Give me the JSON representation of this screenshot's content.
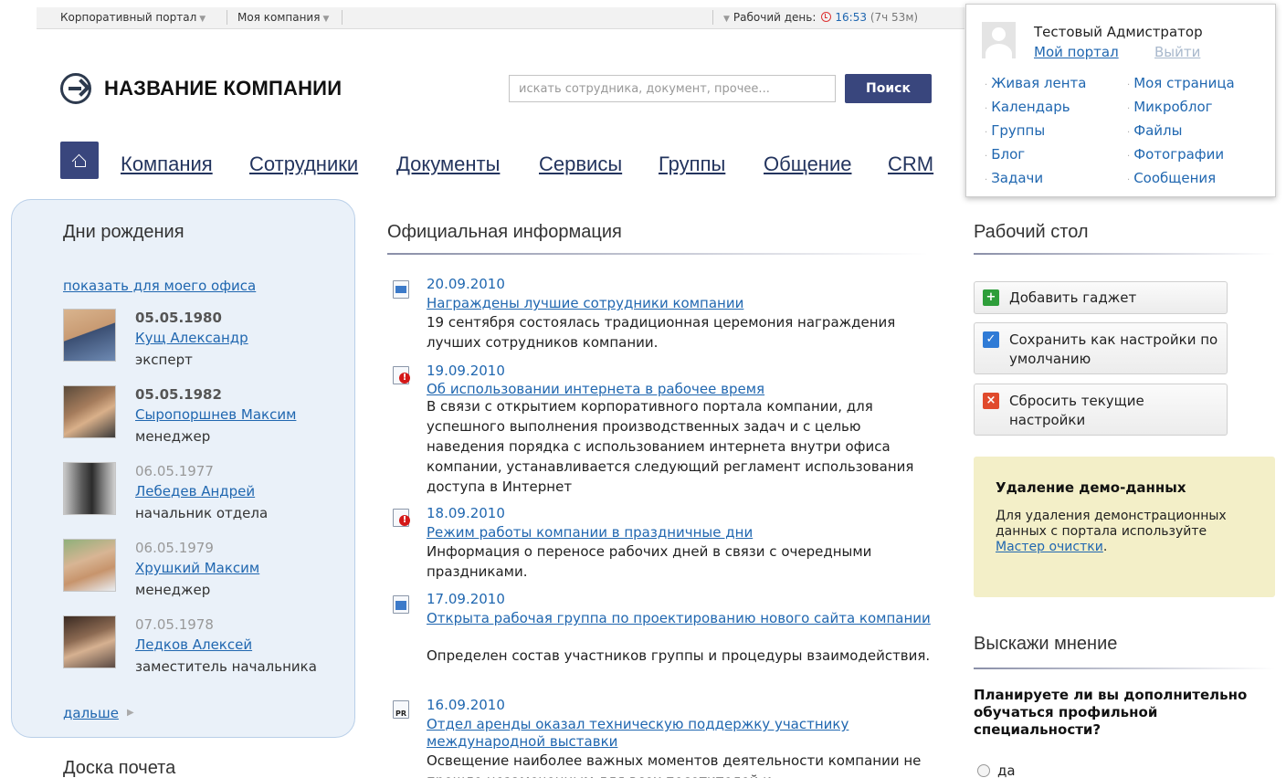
{
  "topbar": {
    "portal_menu": "Корпоративный портал",
    "company_menu": "Моя компания",
    "workday_label": "Рабочий день:",
    "time": "16:53",
    "time_extra": "(7ч 53м)"
  },
  "logo": {
    "text": "НАЗВАНИЕ КОМПАНИИ"
  },
  "search": {
    "placeholder": "искать сотрудника, документ, прочее...",
    "button": "Поиск"
  },
  "nav": {
    "items": [
      "Компания",
      "Сотрудники",
      "Документы",
      "Сервисы",
      "Группы",
      "Общение",
      "CRM"
    ]
  },
  "user": {
    "name": "Тестовый Адмистратор",
    "portal_link": "Мой портал",
    "logout_link": "Выйти",
    "links": [
      "Живая лента",
      "Моя страница",
      "Календарь",
      "Микроблог",
      "Группы",
      "Файлы",
      "Блог",
      "Фотографии",
      "Задачи",
      "Сообщения"
    ]
  },
  "birthdays": {
    "title": "Дни рождения",
    "show_office": "показать для моего офиса",
    "people": [
      {
        "date": "05.05.1980",
        "name": "Кущ Александр",
        "role": "эксперт"
      },
      {
        "date": "05.05.1982",
        "name": "Сыропоршнев Максим",
        "role": "менеджер"
      },
      {
        "date": "06.05.1977",
        "name": "Лебедев Андрей",
        "role": "начальник отдела"
      },
      {
        "date": "06.05.1979",
        "name": "Хрушкий Максим",
        "role": "менеджер"
      },
      {
        "date": "07.05.1978",
        "name": "Ледков Алексей",
        "role": "заместитель начальника"
      }
    ],
    "more": "дальше"
  },
  "honor_board": {
    "title": "Доска почета"
  },
  "news": {
    "title": "Официальная информация",
    "items": [
      {
        "date": "20.09.2010",
        "title": "Награждены лучшие сотрудники компании",
        "text": "19 сентября состоялась традиционная церемония награждения лучших сотрудников компании."
      },
      {
        "date": "19.09.2010",
        "title": "Об использовании интернета в рабочее время",
        "text": "В связи с открытием корпоративного портала компании, для успешного выполнения производственных задач и с целью наведения порядка с использованием интернета внутри офиса компании, устанавливается следующий регламент использования доступа в Интернет"
      },
      {
        "date": "18.09.2010",
        "title": "Режим работы компании в праздничные дни",
        "text": "Информация о переносе рабочих дней в связи с очередными праздниками."
      },
      {
        "date": "17.09.2010",
        "title": "Открыта рабочая группа по проектированию нового сайта компании",
        "text": "Определен состав участников группы и процедуры взаимодействия."
      },
      {
        "date": "16.09.2010",
        "title": "Отдел аренды оказал техническую поддержку участнику международной выставки",
        "text": "Освещение наиболее важных моментов деятельности компании не прошло незамеченным для всех посетителей и"
      }
    ]
  },
  "desktop": {
    "title": "Рабочий стол",
    "add_gadget": "Добавить гаджет",
    "save_default": "Сохранить как настройки по умолчанию",
    "reset": "Сбросить текущие настройки"
  },
  "demo": {
    "title": "Удаление демо-данных",
    "text": "Для удаления демонстрационных данных с портала используйте",
    "link": "Мастер очистки",
    "tail": "."
  },
  "poll": {
    "title": "Выскажи мнение",
    "question": "Планируете ли вы дополнительно обучаться профильной специальности?",
    "option_1": "да"
  }
}
